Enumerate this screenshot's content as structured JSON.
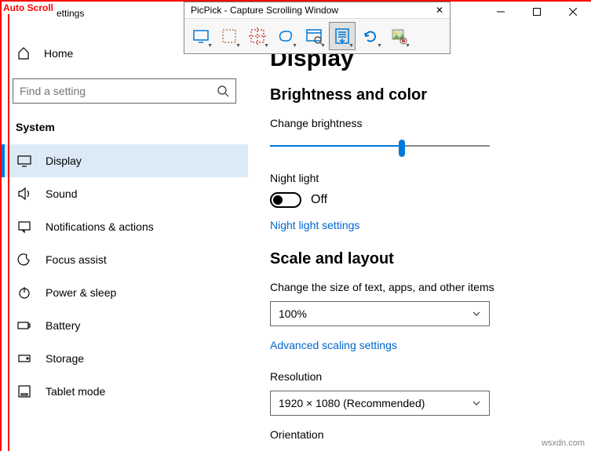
{
  "overlay": {
    "autoScroll": "Auto Scroll"
  },
  "window": {
    "title": "ettings"
  },
  "picpick": {
    "title": "PicPick - Capture Scrolling Window",
    "tools": [
      "fullscreen",
      "region",
      "fixed-region",
      "freehand",
      "window",
      "scrolling",
      "repeat",
      "color-picker"
    ]
  },
  "sidebar": {
    "home": "Home",
    "searchPlaceholder": "Find a setting",
    "category": "System",
    "items": [
      {
        "id": "display",
        "label": "Display",
        "active": true
      },
      {
        "id": "sound",
        "label": "Sound"
      },
      {
        "id": "notifications",
        "label": "Notifications & actions"
      },
      {
        "id": "focus",
        "label": "Focus assist"
      },
      {
        "id": "power",
        "label": "Power & sleep"
      },
      {
        "id": "battery",
        "label": "Battery"
      },
      {
        "id": "storage",
        "label": "Storage"
      },
      {
        "id": "tablet",
        "label": "Tablet mode"
      }
    ]
  },
  "content": {
    "pageTitle": "Display",
    "section1": "Brightness and color",
    "brightnessLabel": "Change brightness",
    "brightnessPercent": 60,
    "nightLightLabel": "Night light",
    "nightLightState": "Off",
    "nightLightLink": "Night light settings",
    "section2": "Scale and layout",
    "scaleLabel": "Change the size of text, apps, and other items",
    "scaleValue": "100%",
    "scaleLink": "Advanced scaling settings",
    "resolutionLabel": "Resolution",
    "resolutionValue": "1920 × 1080 (Recommended)",
    "orientationLabel": "Orientation"
  },
  "watermark": "wsxdn.com"
}
